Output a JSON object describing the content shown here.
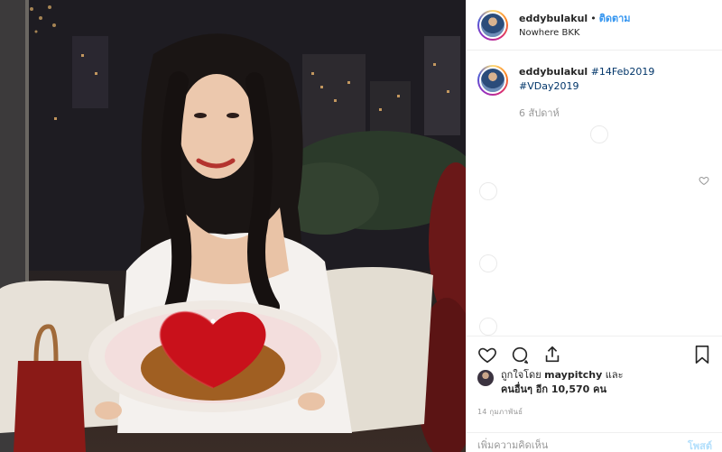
{
  "post": {
    "username": "eddybulakul",
    "dot": "•",
    "follow_label": "ติดตาม",
    "location": "Nowhere BKK"
  },
  "caption": {
    "username": "eddybulakul",
    "hashtags": [
      "#14Feb2019",
      "#VDay2019"
    ],
    "time_ago": "6 สัปดาห์"
  },
  "likes": {
    "prefix": "ถูกใจโดย",
    "liked_by": "maypitchy",
    "and": "และ",
    "others_label": "คนอื่นๆ อีก 10,570 คน"
  },
  "post_date": "14 กุมภาพันธ์",
  "comment": {
    "placeholder": "เพิ่มความคิดเห็น",
    "post_label": "โพสต์"
  },
  "icons": {
    "like": "heart-icon",
    "comment": "comment-icon",
    "share": "share-icon",
    "save": "bookmark-icon"
  },
  "colors": {
    "link": "#3897f0",
    "hashtag": "#003569",
    "muted": "#999999"
  }
}
